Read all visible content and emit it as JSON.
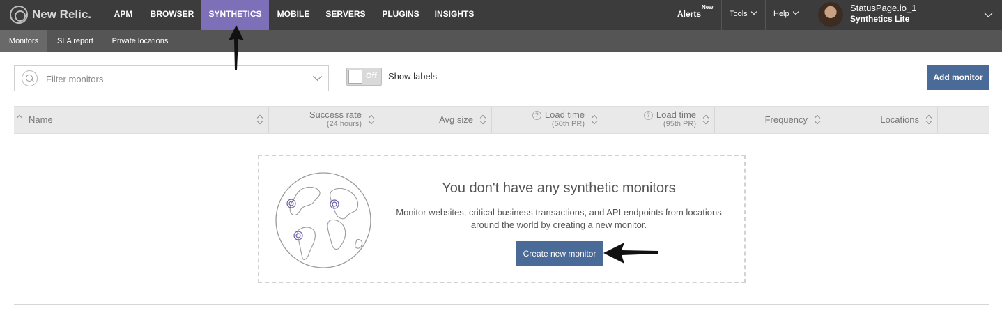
{
  "brand": {
    "name": "New Relic."
  },
  "top_nav": [
    {
      "label": "APM",
      "active": false
    },
    {
      "label": "BROWSER",
      "active": false
    },
    {
      "label": "SYNTHETICS",
      "active": true
    },
    {
      "label": "MOBILE",
      "active": false
    },
    {
      "label": "SERVERS",
      "active": false
    },
    {
      "label": "PLUGINS",
      "active": false
    },
    {
      "label": "INSIGHTS",
      "active": false
    }
  ],
  "header_right": {
    "alerts": "Alerts",
    "alerts_badge": "New",
    "tools": "Tools",
    "help": "Help",
    "account_name": "StatusPage.io_1",
    "account_plan": "Synthetics Lite"
  },
  "sub_nav": [
    {
      "label": "Monitors",
      "active": true
    },
    {
      "label": "SLA report",
      "active": false
    },
    {
      "label": "Private locations",
      "active": false
    }
  ],
  "toolbar": {
    "filter_placeholder": "Filter monitors",
    "toggle_state": "Off",
    "show_labels": "Show labels",
    "add_monitor": "Add monitor"
  },
  "table": {
    "columns": [
      {
        "label": "Name",
        "sub": ""
      },
      {
        "label": "Success rate",
        "sub": "(24 hours)"
      },
      {
        "label": "Avg size",
        "sub": ""
      },
      {
        "label": "Load time",
        "sub": "(50th PR)"
      },
      {
        "label": "Load time",
        "sub": "(95th PR)"
      },
      {
        "label": "Frequency",
        "sub": ""
      },
      {
        "label": "Locations",
        "sub": ""
      }
    ]
  },
  "empty_state": {
    "title": "You don't have any synthetic monitors",
    "description": "Monitor websites, critical business transactions, and API endpoints from locations around the world by creating a new monitor.",
    "cta": "Create new monitor"
  },
  "colors": {
    "topbar": "#3c3c3c",
    "subbar": "#555555",
    "active_tab": "#7e70b8",
    "button": "#4a6a97"
  }
}
